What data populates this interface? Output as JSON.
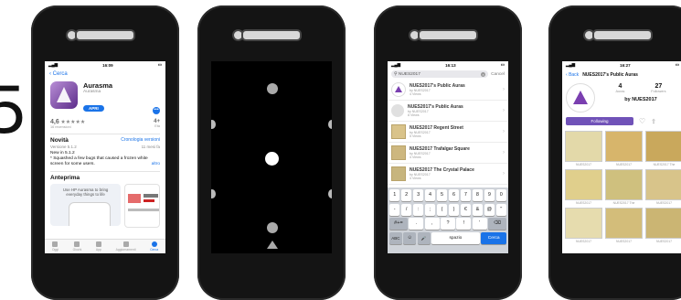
{
  "partial_digit": "5",
  "status": {
    "time": "16:09",
    "time3": "16:13",
    "time4": "16:27"
  },
  "appstore": {
    "back_label": "Cerca",
    "app_name": "Aurasma",
    "developer": "Aurasma",
    "get_button": "APRI",
    "more_button": "•••",
    "rating": "4,6",
    "stars": "★★★★★",
    "rating_count": "16 recensioni",
    "age": "4+",
    "age_caption": "Età",
    "whats_new_title": "Novità",
    "version_history": "Cronologia versioni",
    "version": "Versione 5.1.2",
    "age_updated": "11 mesi fa",
    "release_title": "New in 5.1.2",
    "release_note": "* Squashed a few bugs that caused a frozen white screen for some users.",
    "more_link": "altro",
    "preview_title": "Anteprima",
    "preview_caption": "Use HP Aurasma to bring everyday things to life",
    "tabs": [
      "Oggi",
      "Giochi",
      "App",
      "Aggiornamenti",
      "Cerca"
    ]
  },
  "search": {
    "query": "NUES2017",
    "cancel_label": "Cancel",
    "results": [
      {
        "title": "NUES2017's Public Auras",
        "sub1": "by NUES2017",
        "sub2": "4 Views"
      },
      {
        "title": "NUES2017's Public Auras",
        "sub1": "by NUES2017",
        "sub2": "8 Views"
      },
      {
        "title": "NUES2017 Regent Street",
        "sub1": "by NUES2017",
        "sub2": "5 Views"
      },
      {
        "title": "NUES2017 Trafalgar Square",
        "sub1": "by NUES2017",
        "sub2": "4 Views"
      },
      {
        "title": "NUES2017 The Crystal Palace",
        "sub1": "by NUES2017",
        "sub2": "4 Views"
      }
    ],
    "keyboard": {
      "row1": [
        "1",
        "2",
        "3",
        "4",
        "5",
        "6",
        "7",
        "8",
        "9",
        "0"
      ],
      "row2": [
        "-",
        "/",
        ":",
        ";",
        "(",
        ")",
        "€",
        "&",
        "@",
        "\""
      ],
      "row3": [
        "#+=",
        ".",
        ",",
        "?",
        "!",
        "'",
        "⌫"
      ],
      "row4": [
        "ABC",
        "☺",
        "🎤",
        "spazio",
        "Cerca"
      ]
    }
  },
  "profile": {
    "back_label": "Back",
    "title": "NUES2017's Public Auras",
    "auras_count": "4",
    "auras_label": "Auras",
    "followers_count": "27",
    "followers_label": "Followers",
    "by_label": "by NUES2017",
    "follow_button": "Following",
    "grid_labels": [
      "NUES2017",
      "NUES2017",
      "NUES2017 The",
      "NUES2017",
      "NUES2017 The",
      "NUES2017",
      "NUES2017",
      "NUES2017",
      "NUES2017"
    ]
  },
  "colors": {
    "accent": "#1a73e8",
    "purple": "#7052b8",
    "map": "#d9c38a"
  }
}
